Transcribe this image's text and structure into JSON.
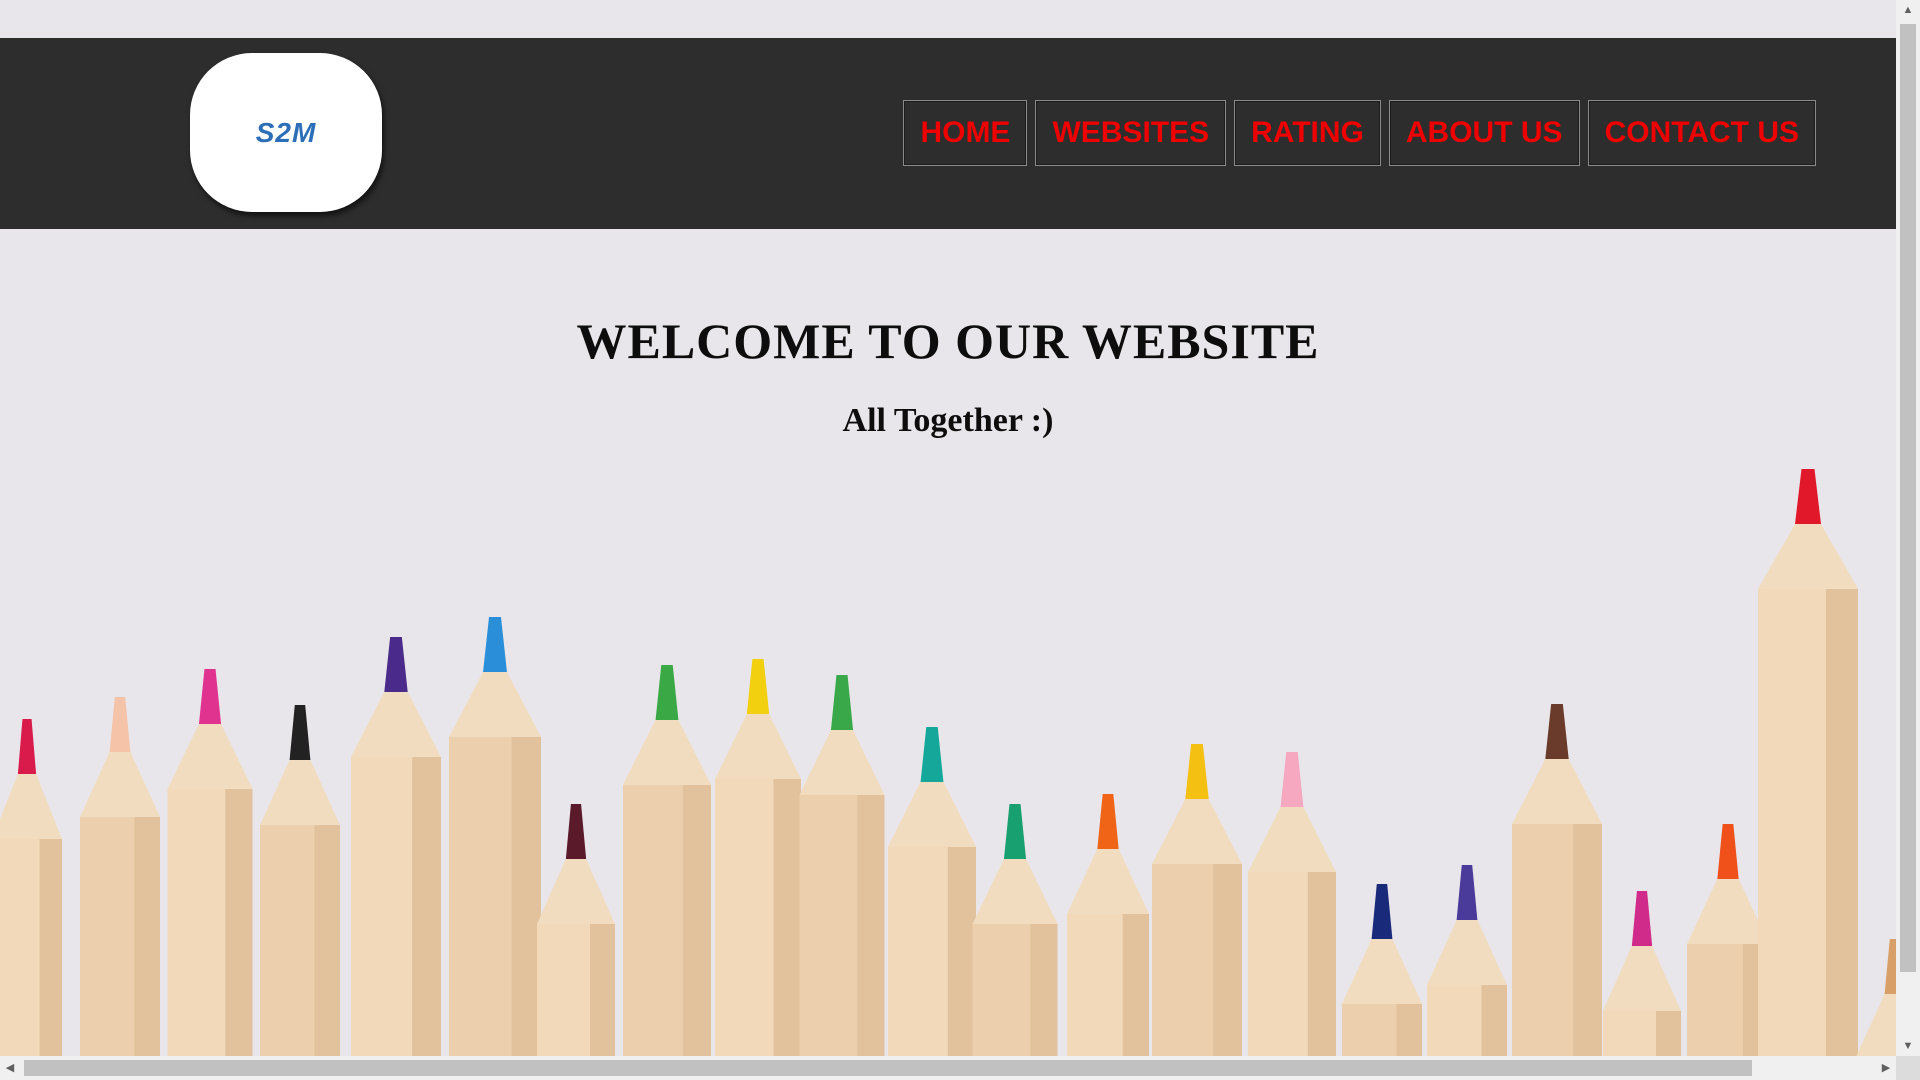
{
  "header": {
    "logo_text": "S2M",
    "nav": [
      {
        "label": "HOME"
      },
      {
        "label": "WEBSITES"
      },
      {
        "label": "RATING"
      },
      {
        "label": "ABOUT US"
      },
      {
        "label": "CONTACT US"
      }
    ]
  },
  "hero": {
    "title": "WELCOME TO OUR WEBSITE",
    "subtitle": "All Together :)"
  },
  "background": {
    "image": "colored-pencils-image"
  },
  "colors": {
    "header_bg": "#2d2d2d",
    "nav_text": "#ee0000",
    "logo_text": "#2c6fb8",
    "page_bg": "#e8e6ea"
  },
  "scrollbars": {
    "up_arrow": "▲",
    "down_arrow": "▼",
    "left_arrow": "◀",
    "right_arrow": "▶"
  }
}
